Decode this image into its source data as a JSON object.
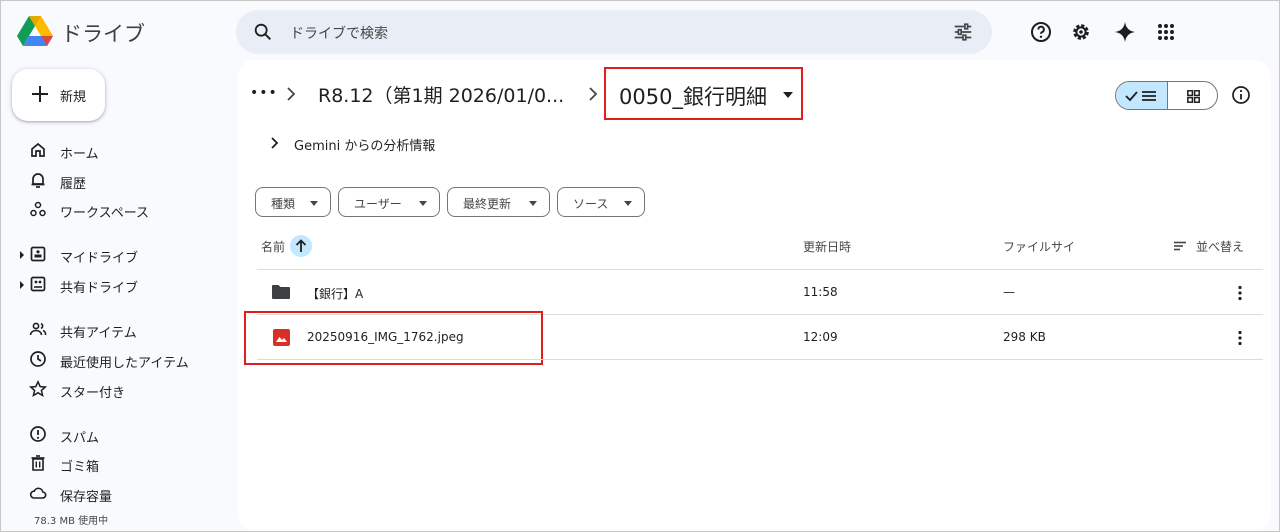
{
  "app": {
    "title": "ドライブ",
    "search_placeholder": "ドライブで検索"
  },
  "new_button": {
    "label": "新規"
  },
  "sidebar": {
    "items": [
      {
        "label": "ホーム",
        "icon": "home-icon"
      },
      {
        "label": "履歴",
        "icon": "bell-icon"
      },
      {
        "label": "ワークスペース",
        "icon": "workspaces-icon"
      },
      {
        "label": "マイドライブ",
        "icon": "my-drive-icon"
      },
      {
        "label": "共有ドライブ",
        "icon": "shared-drives-icon"
      },
      {
        "label": "共有アイテム",
        "icon": "people-icon"
      },
      {
        "label": "最近使用したアイテム",
        "icon": "clock-icon"
      },
      {
        "label": "スター付き",
        "icon": "star-icon"
      },
      {
        "label": "スパム",
        "icon": "spam-icon"
      },
      {
        "label": "ゴミ箱",
        "icon": "trash-icon"
      },
      {
        "label": "保存容量",
        "icon": "cloud-icon"
      }
    ],
    "storage_text": "78.3 MB 使用中"
  },
  "breadcrumb": {
    "ellipsis": "•••",
    "parent": "R8.12（第1期 2026/01/0...",
    "current": "0050_銀行明細"
  },
  "gemini": {
    "label": "Gemini からの分析情報"
  },
  "filters": [
    "種類",
    "ユーザー",
    "最終更新",
    "ソース"
  ],
  "columns": {
    "name": "名前",
    "modified": "更新日時",
    "size": "ファイルサイ",
    "sort": "並べ替え"
  },
  "files": [
    {
      "name": "【銀行】A",
      "modified": "11:58",
      "size": "—",
      "type": "folder"
    },
    {
      "name": "20250916_IMG_1762.jpeg",
      "modified": "12:09",
      "size": "298 KB",
      "type": "image"
    }
  ],
  "colors": {
    "accent": "#c2e7ff",
    "highlight": "#e01e1e",
    "search_bg": "#e9eef6",
    "image_icon": "#d93025"
  }
}
